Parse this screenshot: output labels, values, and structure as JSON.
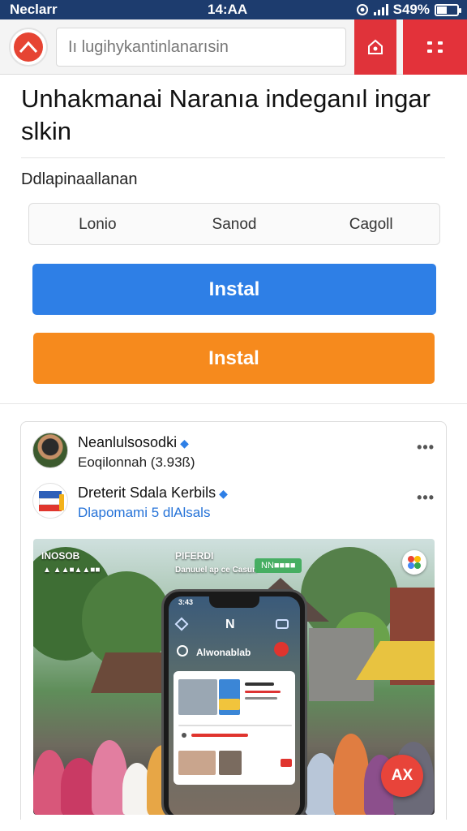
{
  "status_bar": {
    "carrier": "Neclarr",
    "time": "14:AA",
    "battery": "S49%",
    "battery_level": 0.49
  },
  "browser": {
    "url_text": "Iı lugihykantinlanarısin",
    "logo_icon": "app-logo-icon",
    "home_icon": "home-icon",
    "menu_icon": "menu-icon",
    "accent_color": "#e2383e"
  },
  "page": {
    "headline": "Unhakmanai Naranıa indeganıl ingar slkin",
    "subheading": "Ddlapinaallanan",
    "segments": [
      "Lonio",
      "Sanod",
      "Cagoll"
    ],
    "install_primary": "Instal",
    "install_secondary": "Instal",
    "primary_color": "#2e7fe6",
    "secondary_color": "#f68a1d"
  },
  "card": {
    "posts": [
      {
        "name": "Neanlulsosodki",
        "sub": "Eoqilonnah (3.93ß)",
        "verified_icon": "verified-icon",
        "more_icon": "more-dots-icon"
      },
      {
        "name": "Dreterit Sdala Kerbils",
        "sub": "Dlapomami 5 dlAlsals",
        "verified_icon": "verified-icon",
        "more_icon": "more-dots-icon"
      }
    ],
    "image": {
      "label_left": "INOSOB",
      "label_left_sub": "▲ ▲▲■▲▲■■",
      "label_center": "PIFERDI",
      "label_center_sub": "Danuuel ap ce Casun",
      "chip_text": "NN■■■■",
      "phone_time": "3:43",
      "phone_logo": "N",
      "phone_title": "Alwonablab",
      "fab_label": "AX"
    }
  }
}
